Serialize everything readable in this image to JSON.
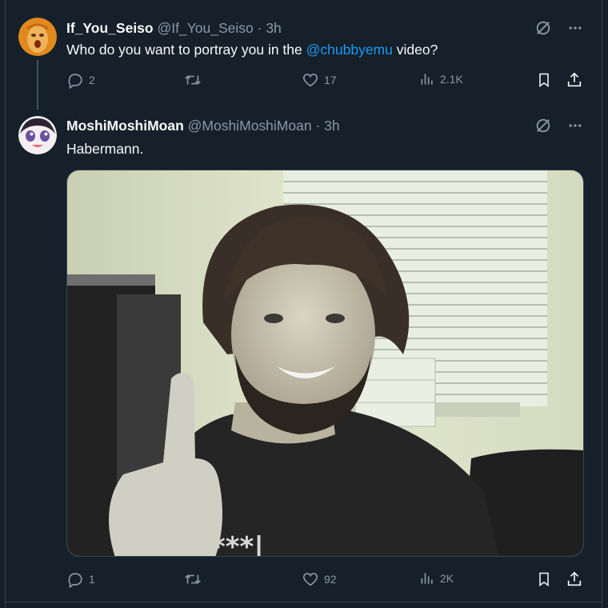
{
  "tweet1": {
    "name": "If_You_Seiso",
    "handle": "@If_You_Seiso",
    "separator": "·",
    "time": "3h",
    "text_before": "Who do you want to portray you in the ",
    "mention": "@chubbyemu",
    "text_after": " video?",
    "replies": "2",
    "likes": "17",
    "views": "2.1K"
  },
  "tweet2": {
    "name": "MoshiMoshiMoan",
    "handle": "@MoshiMoshiMoan",
    "separator": "·",
    "time": "3h",
    "text": "Habermann.",
    "replies": "1",
    "likes": "92",
    "views": "2K"
  },
  "colors": {
    "background": "#15202b",
    "text": "#f7f9f9",
    "muted": "#8b98a5",
    "accent": "#1d9bf0",
    "border": "#38444d"
  },
  "icons": [
    "grok-icon",
    "more-icon",
    "reply-icon",
    "retweet-icon",
    "like-icon",
    "views-icon",
    "bookmark-icon",
    "share-icon"
  ]
}
